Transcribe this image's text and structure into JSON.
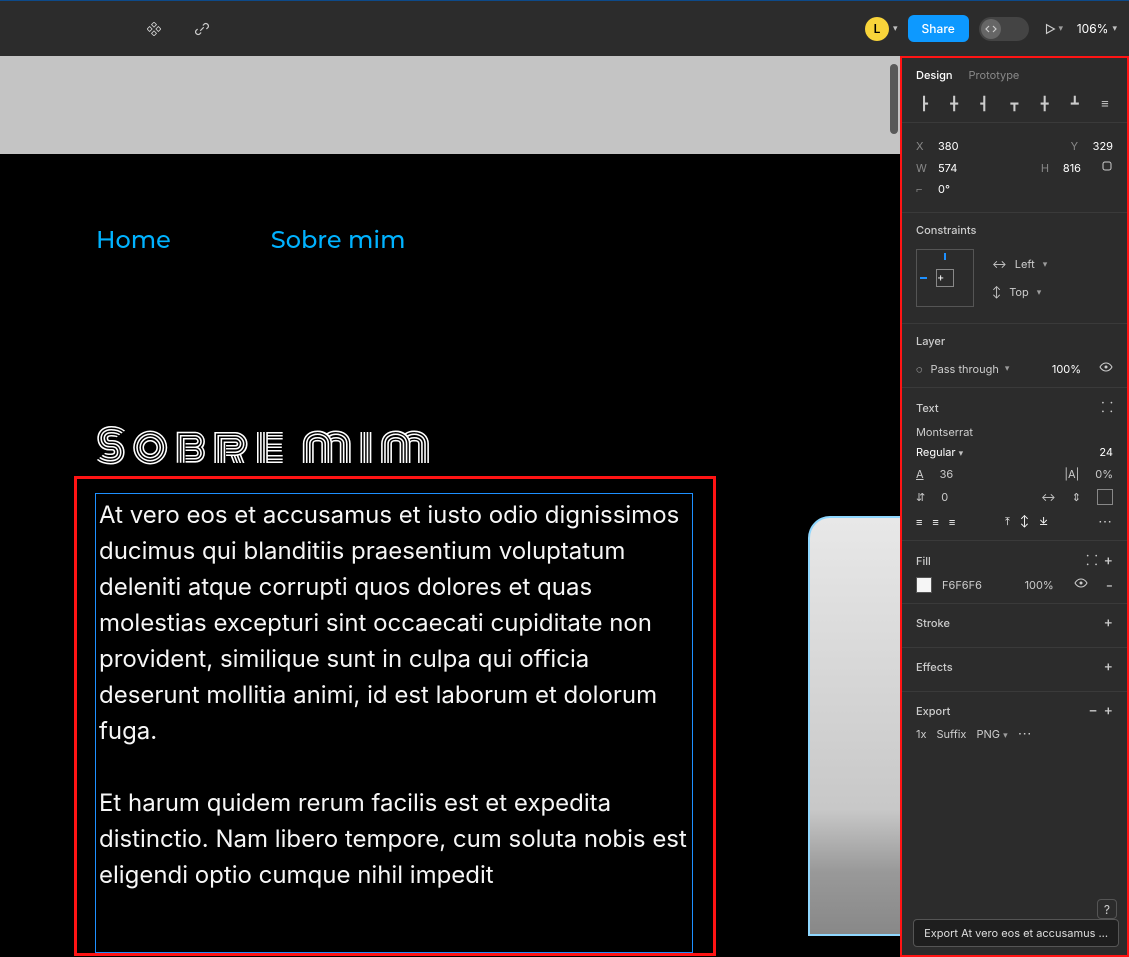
{
  "toolbar": {
    "avatar_initial": "L",
    "share_label": "Share",
    "zoom": "106%"
  },
  "canvas": {
    "nav": {
      "home": "Home",
      "about": "Sobre mim"
    },
    "title": "Sobre mim",
    "paragraph1": "At vero eos et accusamus et iusto odio dignissimos ducimus qui blanditiis praesentium voluptatum deleniti atque corrupti quos dolores et quas molestias excepturi sint occaecati cupiditate non provident, similique sunt in culpa qui officia deserunt mollitia animi, id est laborum et dolorum fuga.",
    "paragraph2": "Et harum quidem rerum facilis est et expedita distinctio. Nam libero tempore, cum soluta nobis est eligendi optio cumque nihil impedit"
  },
  "panel": {
    "tabs": {
      "design": "Design",
      "prototype": "Prototype"
    },
    "transform": {
      "x_lbl": "X",
      "x": "380",
      "y_lbl": "Y",
      "y": "329",
      "w_lbl": "W",
      "w": "574",
      "h_lbl": "H",
      "h": "816",
      "angle": "0°"
    },
    "constraints": {
      "title": "Constraints",
      "horiz": "Left",
      "vert": "Top"
    },
    "layer": {
      "title": "Layer",
      "blend": "Pass through",
      "opacity": "100%"
    },
    "text": {
      "title": "Text",
      "font": "Montserrat",
      "weight": "Regular",
      "size": "24",
      "line_height": "36",
      "letter_spacing": "0%",
      "para_spacing": "0"
    },
    "fill": {
      "title": "Fill",
      "hex": "F6F6F6",
      "opacity": "100%"
    },
    "stroke": {
      "title": "Stroke"
    },
    "effects": {
      "title": "Effects"
    },
    "export": {
      "title": "Export",
      "scale": "1x",
      "suffix": "Suffix",
      "format": "PNG",
      "tooltip": "Export At vero eos et accusamus ..."
    }
  }
}
